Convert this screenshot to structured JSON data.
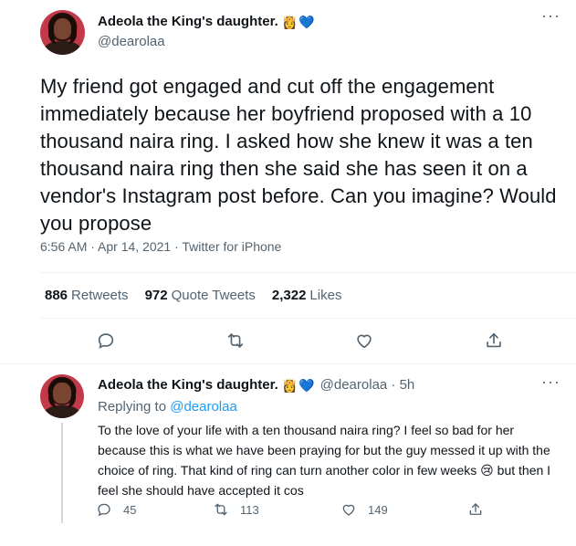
{
  "main_tweet": {
    "author_name": "Adeola the King's daughter.",
    "author_emoji": "👸",
    "author_heart": "💙",
    "handle": "@dearolaa",
    "more": "···",
    "text": "My friend got engaged and cut off the engagement immediately because her boyfriend proposed with a 10 thousand naira ring. I asked how she knew it was a ten thousand naira ring then she said she has seen it on a vendor's Instagram post before. Can you imagine? Would you propose",
    "meta": "6:56 AM · Apr 14, 2021 · Twitter for iPhone",
    "stats": {
      "retweets_count": "886",
      "retweets_label": "Retweets",
      "quotes_count": "972",
      "quotes_label": "Quote Tweets",
      "likes_count": "2,322",
      "likes_label": "Likes"
    },
    "actions": [
      "reply-icon",
      "retweet-icon",
      "like-icon",
      "share-icon"
    ]
  },
  "reply_tweet": {
    "author_name": "Adeola the King's daughter.",
    "author_emoji": "👸",
    "author_heart": "💙",
    "handle_time": "@dearolaa · 5h",
    "more": "···",
    "replying_prefix": "Replying to",
    "replying_mention": "@dearolaa",
    "text": "To the love of your life with a ten thousand naira ring? I feel so bad for her because this is what we have been praying for but the guy messed it up with the choice of ring. That kind of ring can turn another color in few weeks 😢 but then I feel she should have accepted it cos",
    "reply_count": "45",
    "retweet_count": "113",
    "like_count": "149"
  },
  "colors": {
    "text": "#0f1419",
    "muted": "#536471",
    "accent": "#1d9bf0",
    "divider": "#eff3f4"
  }
}
